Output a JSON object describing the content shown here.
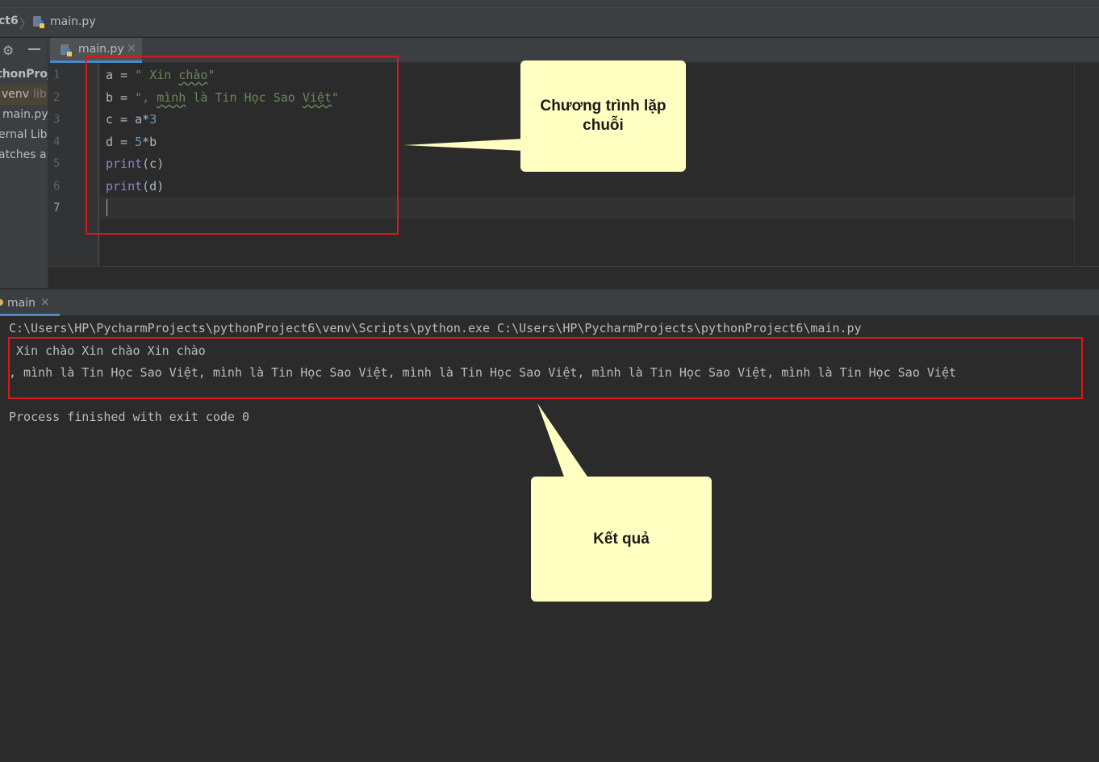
{
  "breadcrumb": {
    "project": "ct6",
    "file": "main.py"
  },
  "sidebar": {
    "items": [
      {
        "label": "thonProj"
      },
      {
        "label": "venv",
        "hint": "libr"
      },
      {
        "label": "main.py"
      },
      {
        "label": "ernal Libr"
      },
      {
        "label": "atches ar"
      }
    ]
  },
  "editor": {
    "tab_label": "main.py",
    "tab_close": "×",
    "line_numbers": [
      "1",
      "2",
      "3",
      "4",
      "5",
      "6",
      "7"
    ],
    "code": {
      "l1_a": "a = ",
      "l1_q1": "\" ",
      "l1_w1": "Xin",
      "l1_sp": " ",
      "l1_w2": "chào",
      "l1_q2": "\"",
      "l2_a": "b = ",
      "l2_q1": "\", ",
      "l2_w1": "mình",
      "l2_mid": " là Tin Học Sao ",
      "l2_w2": "Việt",
      "l2_q2": "\"",
      "l3": "c = a*",
      "l3_n": "3",
      "l4": "d = ",
      "l4_n": "5",
      "l4_rest": "*b",
      "l5_fn": "print",
      "l5_rest": "(c)",
      "l6_fn": "print",
      "l6_rest": "(d)"
    }
  },
  "run": {
    "tab_label": "main",
    "tab_close": "×",
    "command": "C:\\Users\\HP\\PycharmProjects\\pythonProject6\\venv\\Scripts\\python.exe C:\\Users\\HP\\PycharmProjects\\pythonProject6\\main.py",
    "output_line_1": " Xin chào Xin chào Xin chào",
    "output_line_2": ", mình là Tin Học Sao Việt, mình là Tin Học Sao Việt, mình là Tin Học Sao Việt, mình là Tin Học Sao Việt, mình là Tin Học Sao Việt",
    "exit_message": "Process finished with exit code 0"
  },
  "annotations": {
    "callout_program": "Chương trình lặp chuỗi",
    "callout_result": "Kết quả"
  },
  "colors": {
    "highlight_border": "#d9171c",
    "callout_fill": "#ffffc2"
  }
}
